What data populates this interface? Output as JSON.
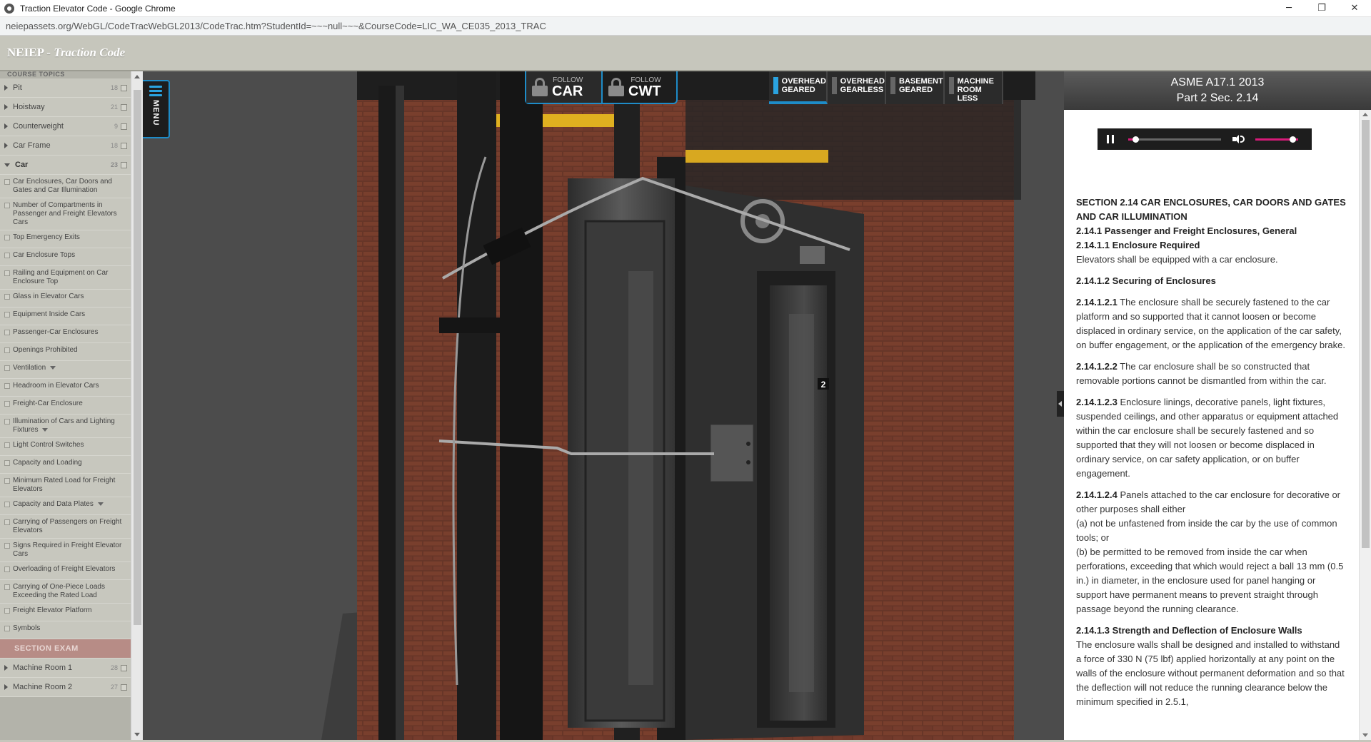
{
  "window": {
    "title": "Traction Elevator Code - Google Chrome",
    "minimize": "─",
    "restore": "❐",
    "close": "✕"
  },
  "browser": {
    "url": "neiepassets.org/WebGL/CodeTracWebGL2013/CodeTrac.htm?StudentId=~~~null~~~&CourseCode=LIC_WA_CE035_2013_TRAC"
  },
  "app": {
    "brand_prefix": "NEIEP - ",
    "brand_name": "Traction Code"
  },
  "sidebar": {
    "header": "COURSE TOPICS",
    "topics_top": [
      {
        "label": "Pit",
        "count": "18"
      },
      {
        "label": "Hoistway",
        "count": "21"
      },
      {
        "label": "Counterweight",
        "count": "9"
      },
      {
        "label": "Car Frame",
        "count": "18"
      },
      {
        "label": "Car",
        "count": "23"
      }
    ],
    "subitems": [
      "Car Enclosures, Car Doors and Gates and Car Illumination",
      "Number of Compartments in Passenger and Freight Elevators Cars",
      "Top Emergency Exits",
      "Car Enclosure Tops",
      "Railing and Equipment on Car Enclosure Top",
      "Glass in Elevator Cars",
      "Equipment Inside Cars",
      "Passenger-Car Enclosures",
      "Openings Prohibited",
      "Ventilation",
      "Headroom in Elevator Cars",
      "Freight-Car Enclosure",
      "Illumination of Cars and Lighting Fixtures",
      "Light Control Switches",
      "Capacity and Loading",
      "Minimum Rated Load for Freight Elevators",
      "Capacity and Data Plates",
      "Carrying of Passengers on Freight Elevators",
      "Signs Required in Freight Elevator Cars",
      "Overloading of Freight Elevators",
      "Carrying of One-Piece Loads Exceeding the Rated Load",
      "Freight Elevator Platform",
      "Symbols"
    ],
    "exam_label": "SECTION EXAM",
    "topics_bottom": [
      {
        "label": "Machine Room 1",
        "count": "28"
      },
      {
        "label": "Machine Room 2",
        "count": "27"
      }
    ]
  },
  "menu_tab": {
    "label": "MENU"
  },
  "follow": {
    "small": "FOLLOW",
    "car": "CAR",
    "cwt": "CWT"
  },
  "elevator_types": [
    {
      "label": "OVERHEAD\nGEARED",
      "active": true
    },
    {
      "label": "OVERHEAD\nGEARLESS",
      "active": false
    },
    {
      "label": "BASEMENT\nGEARED",
      "active": false
    },
    {
      "label": "MACHINE\nROOM LESS",
      "active": false
    }
  ],
  "scene": {
    "floor_number": "2"
  },
  "panel": {
    "code_title": "ASME A17.1 2013",
    "code_section": "Part 2 Sec. 2.14",
    "audio": {
      "progress": 0.08,
      "volume": 0.8
    },
    "doc": {
      "section_title": "SECTION 2.14 CAR ENCLOSURES, CAR DOORS AND GATES AND CAR ILLUMINATION",
      "h1": "2.14.1 Passenger and Freight Enclosures, General",
      "h2": "2.14.1.1 Enclosure Required",
      "p_enclosure": "Elevators shall be equipped with a car enclosure.",
      "h3": "2.14.1.2 Securing of Enclosures",
      "n1": "2.14.1.2.1",
      "p1": " The enclosure shall be securely fastened to the car platform and so supported that it cannot loosen or become displaced in ordinary service, on the application of the car safety, on buffer engagement, or the application of the emergency brake.",
      "n2": "2.14.1.2.2",
      "p2": " The car enclosure shall be so constructed that removable portions cannot be dismantled from within the car.",
      "n3": "2.14.1.2.3",
      "p3": " Enclosure linings, decorative panels, light fixtures, suspended ceilings, and other apparatus or equipment attached within the car enclosure shall be securely fastened and so supported that they will not loosen or become displaced in ordinary service, on car safety application, or on buffer engagement.",
      "n4": "2.14.1.2.4",
      "p4": " Panels attached to the car enclosure for decorative or other purposes shall either",
      "p4a": "(a) not be unfastened from inside the car by the use of common tools; or",
      "p4b": "(b) be permitted to be removed from inside the car when perforations, exceeding that which would reject a ball 13 mm (0.5 in.) in diameter, in the enclosure used for panel hanging or support have permanent means to prevent straight through passage beyond the running clearance.",
      "h4": "2.14.1.3 Strength and Deflection of Enclosure Walls",
      "p5": "The enclosure walls shall be designed and installed to withstand a force of 330 N (75 lbf) applied horizontally at any point on the walls of the enclosure without permanent deformation and so that the deflection will not reduce the running clearance below the minimum specified in 2.5.1,"
    }
  }
}
